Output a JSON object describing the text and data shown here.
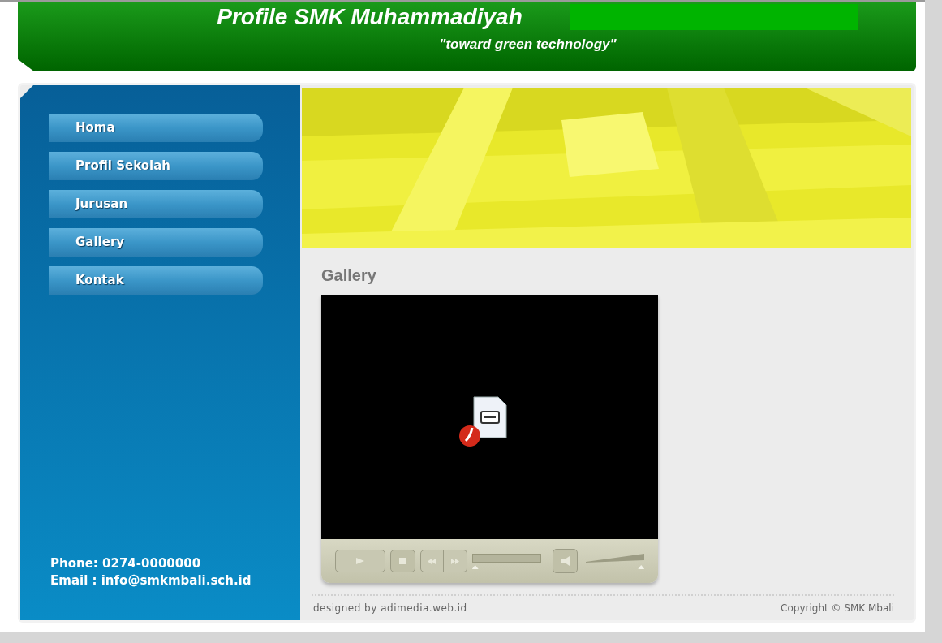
{
  "header": {
    "title": "Profile SMK Muhammadiyah",
    "tagline": "\"toward green technology\""
  },
  "nav": {
    "items": [
      {
        "label": "Homa"
      },
      {
        "label": "Profil Sekolah"
      },
      {
        "label": "Jurusan"
      },
      {
        "label": "Gallery"
      },
      {
        "label": "Kontak"
      }
    ]
  },
  "contact": {
    "phone": "Phone: 0274-0000000",
    "email": "Email : info@smkmbali.sch.id"
  },
  "content": {
    "heading": "Gallery",
    "player": {
      "progress": {
        "level": 0
      },
      "volume": {
        "level": 1
      }
    }
  },
  "footer": {
    "designer": "designed by adimedia.web.id",
    "copyright": "Copyright © SMK Mbali"
  }
}
